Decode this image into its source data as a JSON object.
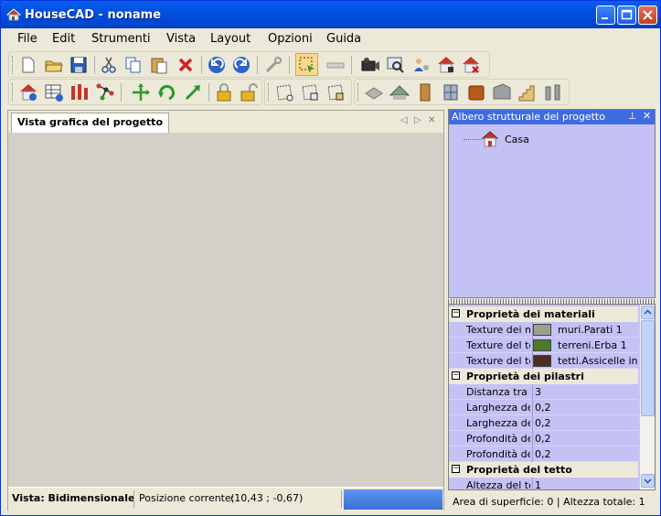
{
  "window": {
    "title": "HouseCAD - noname"
  },
  "menu": [
    "File",
    "Edit",
    "Strumenti",
    "Vista",
    "Layout",
    "Opzioni",
    "Guida"
  ],
  "left_panel": {
    "tab_label": "Vista grafica del progetto"
  },
  "status": {
    "view": "Vista: Bidimensionale",
    "position_label": "Posizione corrente:",
    "position_value": "(10,43 ; -0,67)"
  },
  "tree_panel": {
    "title": "Albero strutturale del progetto",
    "root_item": "Casa"
  },
  "properties": {
    "cat_materials": "Proprietà dei materiali",
    "tex_walls_name": "Texture dei muri",
    "tex_walls_value": "muri.Parati 1",
    "tex_walls_color": "#9aa08f",
    "tex_terrain_name": "Texture del terreno",
    "tex_terrain_value": "terreni.Erba 1",
    "tex_terrain_color": "#4a7a2a",
    "tex_roof_name": "Texture del tetto",
    "tex_roof_value": "tetti.Assicelle in cedro",
    "tex_roof_color": "#4a3020",
    "cat_pillars": "Proprietà dei pilastri",
    "pillar_distance_name": "Distanza tra i pilastri",
    "pillar_distance_value": "3",
    "pillar_width_name": "Larghezza dei pilastri",
    "pillar_width_value": "0,2",
    "pillar_width2_name": "Larghezza dei pilastri",
    "pillar_width2_value": "0,2",
    "pillar_depth_name": "Profondità dei pilastri",
    "pillar_depth_value": "0,2",
    "pillar_depth2_name": "Profondità dei pilastri",
    "pillar_depth2_value": "0,2",
    "cat_roof": "Proprietà del tetto",
    "roof_height_name": "Altezza del tetto",
    "roof_height_value": "1"
  },
  "right_status": {
    "area": "Area di superficie: 0",
    "separator": "|",
    "height": "Altezza totale: 1"
  }
}
